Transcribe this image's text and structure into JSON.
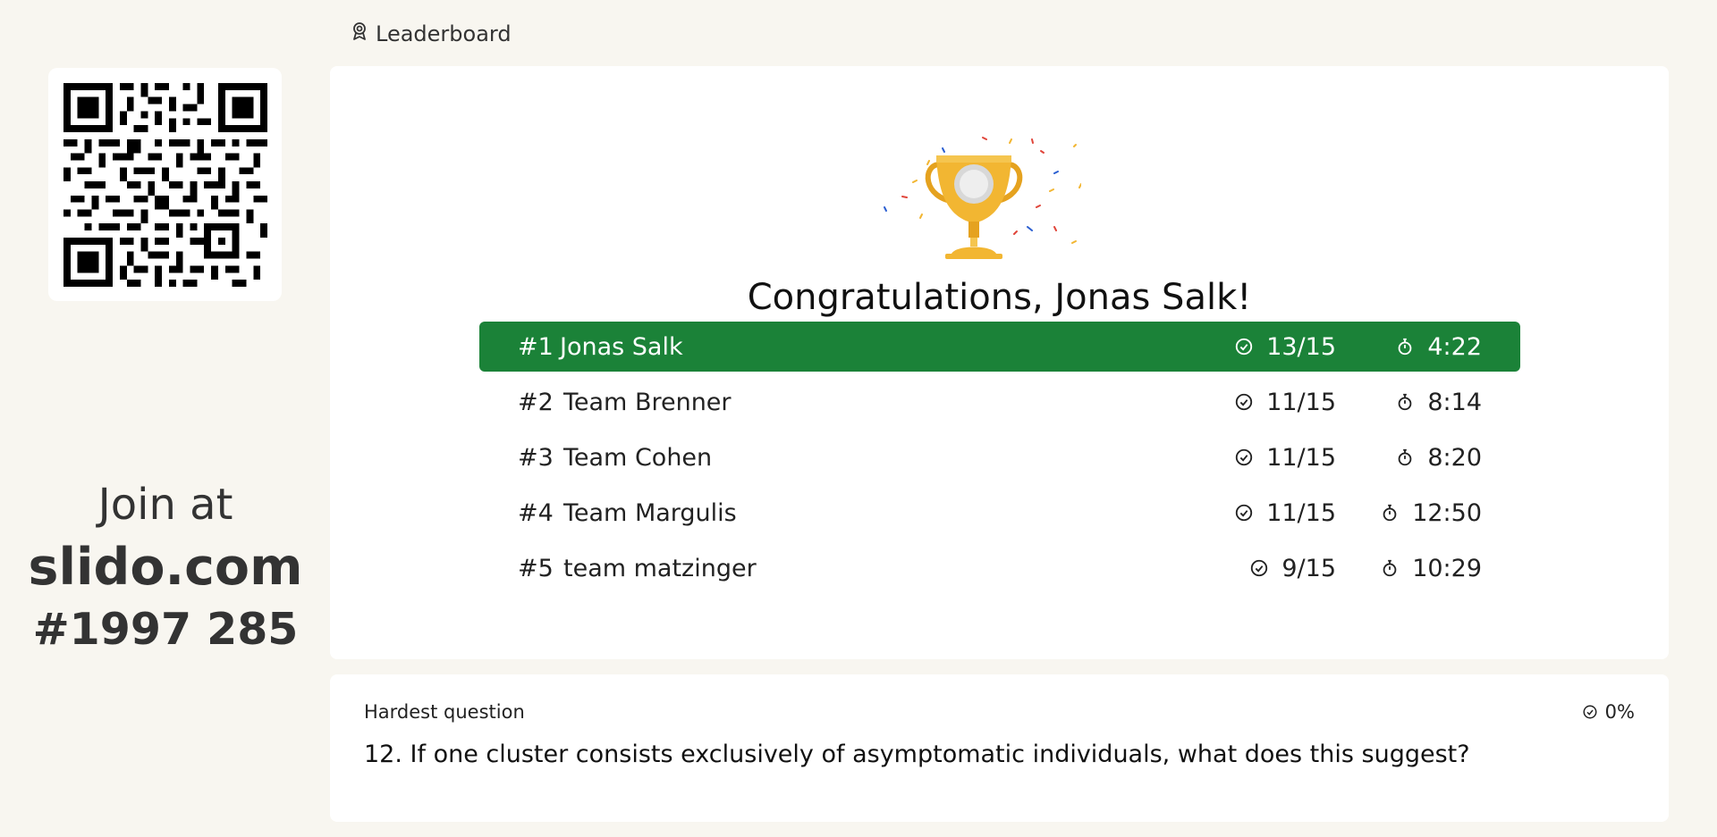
{
  "header": {
    "title": "Leaderboard",
    "icon": "award-icon"
  },
  "join": {
    "lead": "Join at",
    "site": "slido.com",
    "code": "#1997 285"
  },
  "congrats": "Congratulations, Jonas Salk!",
  "leaderboard": [
    {
      "rank": "#1",
      "name": "Jonas Salk",
      "score": "13/15",
      "time": "4:22"
    },
    {
      "rank": "#2",
      "name": "Team Brenner",
      "score": "11/15",
      "time": "8:14"
    },
    {
      "rank": "#3",
      "name": "Team Cohen",
      "score": "11/15",
      "time": "8:20"
    },
    {
      "rank": "#4",
      "name": "Team Margulis",
      "score": "11/15",
      "time": "12:50"
    },
    {
      "rank": "#5",
      "name": "team matzinger",
      "score": "9/15",
      "time": "10:29"
    }
  ],
  "hardest": {
    "label": "Hardest question",
    "percent": "0%",
    "question": "12. If one cluster consists exclusively of asymptomatic individuals, what does this suggest?"
  },
  "colors": {
    "background": "#f8f6f0",
    "winner_row": "#1b8238",
    "trophy": "#f2b632"
  }
}
